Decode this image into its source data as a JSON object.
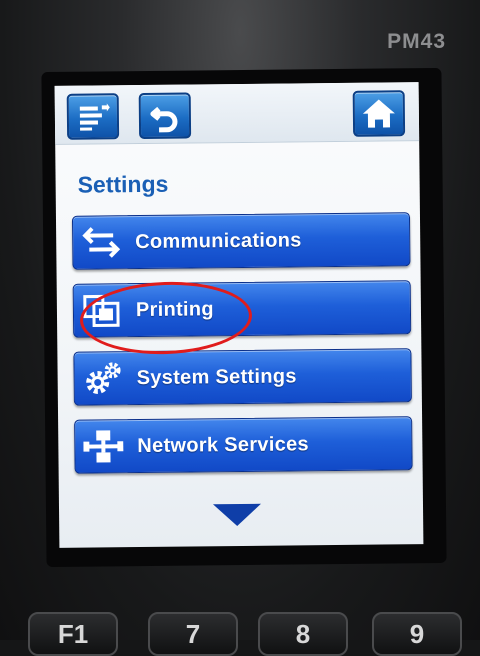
{
  "device": {
    "model": "PM43"
  },
  "toolbar": {
    "menu_icon": "menu-list-icon",
    "back_icon": "back-arrow-icon",
    "home_icon": "home-icon"
  },
  "page": {
    "title": "Settings"
  },
  "menu": {
    "items": [
      {
        "label": "Communications",
        "icon": "arrows-exchange-icon"
      },
      {
        "label": "Printing",
        "icon": "printing-icon"
      },
      {
        "label": "System Settings",
        "icon": "gears-icon"
      },
      {
        "label": "Network Services",
        "icon": "network-icon"
      }
    ],
    "scroll_icon": "chevron-down-icon"
  },
  "annotation": {
    "highlighted_item": "Printing",
    "color": "#e01c1c"
  },
  "keypad": {
    "keys": [
      "F1",
      "7",
      "8",
      "9"
    ]
  },
  "colors": {
    "accent": "#1e5fd9",
    "title": "#1a5fb5"
  }
}
